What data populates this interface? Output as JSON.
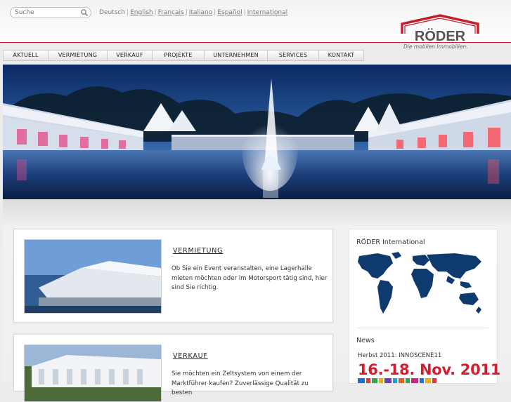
{
  "search": {
    "placeholder": "Suche"
  },
  "languages": [
    {
      "label": "Deutsch",
      "current": true
    },
    {
      "label": "English",
      "current": false
    },
    {
      "label": "Français",
      "current": false
    },
    {
      "label": "Italiano",
      "current": false
    },
    {
      "label": "Español",
      "current": false
    },
    {
      "label": "International",
      "current": false
    }
  ],
  "logo": {
    "name": "RÖDER",
    "tagline": "Die mobilen Immobilien."
  },
  "nav": [
    {
      "label": "AKTUELL"
    },
    {
      "label": "VERMIETUNG"
    },
    {
      "label": "VERKAUF"
    },
    {
      "label": "PROJEKTE"
    },
    {
      "label": "UNTERNEHMEN"
    },
    {
      "label": "SERVICES"
    },
    {
      "label": "KONTAKT"
    }
  ],
  "panels": [
    {
      "title": "VERMIETUNG",
      "text": "Ob Sie ein Event veranstalten, eine Lagerhalle mieten möchten oder im Motorsport tätig sind, hier sind Sie richtig."
    },
    {
      "title": "VERKAUF",
      "text": "Sie möchten ein Zeltsystem von einem der Marktführer kaufen? Zuverlässige Qualität zu besten"
    }
  ],
  "sidebar": {
    "international_title": "RÖDER International",
    "news_title": "News",
    "news_item": "Herbst 2011: INNOSCENE11",
    "news_date": "16.-18. Nov. 2011"
  },
  "colors": {
    "accent_red": "#c41e2a",
    "map_blue": "#0e3a6e",
    "date_red": "#d21f2f"
  }
}
